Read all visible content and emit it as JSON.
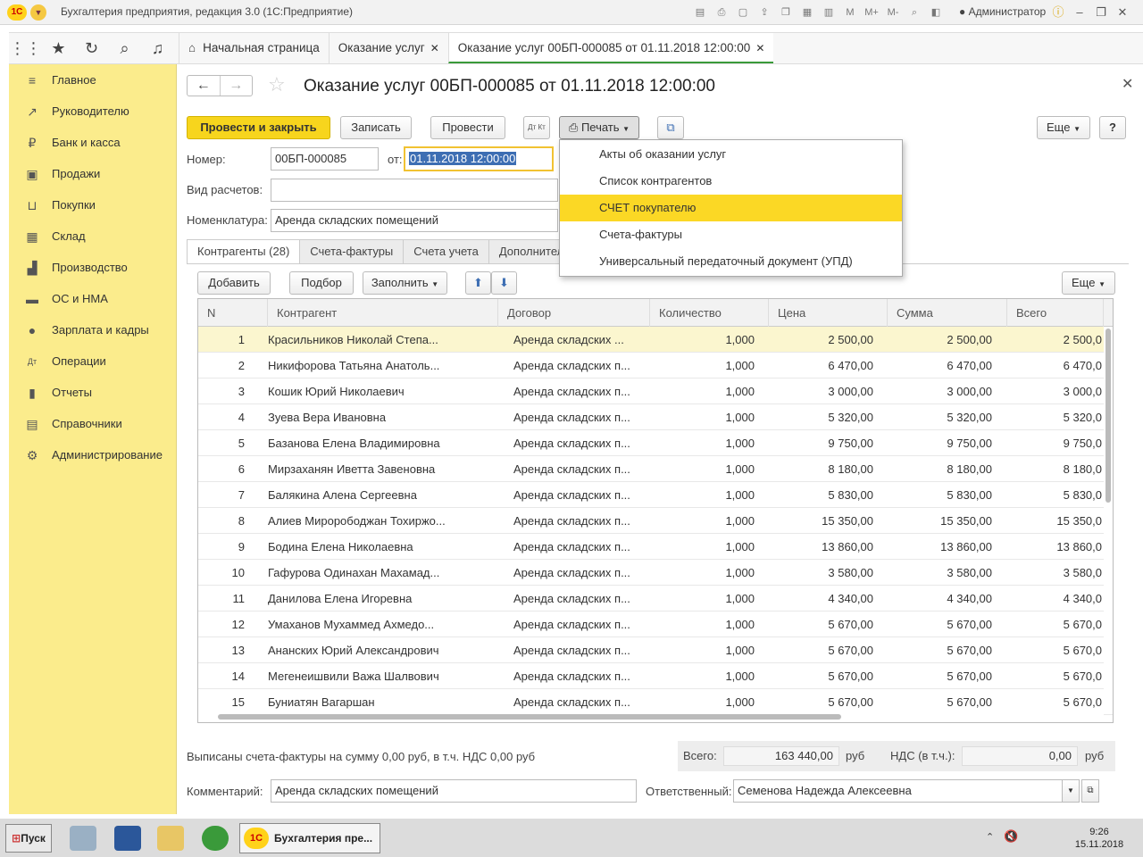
{
  "titlebar": {
    "logo": "1С",
    "title": "Бухгалтерия предприятия, редакция 3.0  (1С:Предприятие)",
    "counters": [
      "M",
      "M+",
      "M-"
    ],
    "user": "Администратор"
  },
  "nav_tabs": [
    {
      "label": "Начальная страница",
      "closable": false
    },
    {
      "label": "Оказание услуг",
      "closable": true
    },
    {
      "label": "Оказание услуг 00БП-000085 от 01.11.2018 12:00:00",
      "closable": true
    }
  ],
  "sidebar": {
    "items": [
      {
        "icon": "menu-icon",
        "glyph": "≡",
        "label": "Главное"
      },
      {
        "icon": "trend-icon",
        "glyph": "↗",
        "label": "Руководителю"
      },
      {
        "icon": "ruble-icon",
        "glyph": "₽",
        "label": "Банк и касса"
      },
      {
        "icon": "bag-icon",
        "glyph": "▣",
        "label": "Продажи"
      },
      {
        "icon": "cart-icon",
        "glyph": "⊔",
        "label": "Покупки"
      },
      {
        "icon": "warehouse-icon",
        "glyph": "▦",
        "label": "Склад"
      },
      {
        "icon": "factory-icon",
        "glyph": "▟",
        "label": "Производство"
      },
      {
        "icon": "truck-icon",
        "glyph": "▬",
        "label": "ОС и НМА"
      },
      {
        "icon": "person-icon",
        "glyph": "●",
        "label": "Зарплата и кадры"
      },
      {
        "icon": "dt-kt-icon",
        "glyph": "Дт",
        "label": "Операции"
      },
      {
        "icon": "bar-chart-icon",
        "glyph": "▮",
        "label": "Отчеты"
      },
      {
        "icon": "book-icon",
        "glyph": "▤",
        "label": "Справочники"
      },
      {
        "icon": "gear-icon",
        "glyph": "⚙",
        "label": "Администрирование"
      }
    ]
  },
  "doc": {
    "title": "Оказание услуг 00БП-000085 от 01.11.2018 12:00:00",
    "buttons": {
      "post_close": "Провести и закрыть",
      "save": "Записать",
      "post": "Провести",
      "dtkt": "Дт Кт",
      "print": "Печать",
      "more": "Еще",
      "help": "?"
    },
    "number_label": "Номер:",
    "number": "00БП-000085",
    "from_label": "от:",
    "date": "01.11.2018 12:00:00",
    "settlement_label": "Вид расчетов:",
    "settlement": "",
    "nomenclature_label": "Номенклатура:",
    "nomenclature": "Аренда складских помещений"
  },
  "print_menu": {
    "items": [
      "Акты об оказании услуг",
      "Список контрагентов",
      "СЧЕТ покупателю",
      "Счета-фактуры",
      "Универсальный передаточный документ (УПД)"
    ],
    "highlighted": 2
  },
  "subtabs": [
    "Контрагенты (28)",
    "Счета-фактуры",
    "Счета учета",
    "Дополнительно"
  ],
  "table_toolbar": {
    "add": "Добавить",
    "pick": "Подбор",
    "fill": "Заполнить",
    "more": "Еще"
  },
  "table": {
    "columns": [
      "N",
      "Контрагент",
      "Договор",
      "Количество",
      "Цена",
      "Сумма",
      "Всего"
    ],
    "rows": [
      [
        "1",
        "Красильников Николай Степа...",
        "Аренда складских  ...",
        "1,000",
        "2 500,00",
        "2 500,00",
        "2 500,0"
      ],
      [
        "2",
        "Никифорова Татьяна Анатоль...",
        "Аренда складских п...",
        "1,000",
        "6 470,00",
        "6 470,00",
        "6 470,0"
      ],
      [
        "3",
        "Кошик Юрий Николаевич",
        "Аренда складских п...",
        "1,000",
        "3 000,00",
        "3 000,00",
        "3 000,0"
      ],
      [
        "4",
        "Зуева Вера Ивановна",
        "Аренда складских п...",
        "1,000",
        "5 320,00",
        "5 320,00",
        "5 320,0"
      ],
      [
        "5",
        "Базанова Елена Владимировна",
        "Аренда складских п...",
        "1,000",
        "9 750,00",
        "9 750,00",
        "9 750,0"
      ],
      [
        "6",
        "Мирзаханян Иветта Завеновна",
        "Аренда складских п...",
        "1,000",
        "8 180,00",
        "8 180,00",
        "8 180,0"
      ],
      [
        "7",
        "Балякина Алена Сергеевна",
        "Аренда складских п...",
        "1,000",
        "5 830,00",
        "5 830,00",
        "5 830,0"
      ],
      [
        "8",
        "Алиев Мирорободжан Тохиржо...",
        "Аренда складских п...",
        "1,000",
        "15 350,00",
        "15 350,00",
        "15 350,0"
      ],
      [
        "9",
        "Бодина Елена Николаевна",
        "Аренда складских п...",
        "1,000",
        "13 860,00",
        "13 860,00",
        "13 860,0"
      ],
      [
        "10",
        "Гафурова Одинахан Махамад...",
        "Аренда складских п...",
        "1,000",
        "3 580,00",
        "3 580,00",
        "3 580,0"
      ],
      [
        "11",
        "Данилова Елена Игоревна",
        "Аренда складских п...",
        "1,000",
        "4 340,00",
        "4 340,00",
        "4 340,0"
      ],
      [
        "12",
        "Умаханов Мухаммед Ахмедо...",
        "Аренда складских п...",
        "1,000",
        "5 670,00",
        "5 670,00",
        "5 670,0"
      ],
      [
        "13",
        "Ананских Юрий Александрович",
        "Аренда складских п...",
        "1,000",
        "5 670,00",
        "5 670,00",
        "5 670,0"
      ],
      [
        "14",
        "Мегенеишвили Важа Шалвович",
        "Аренда складских п...",
        "1,000",
        "5 670,00",
        "5 670,00",
        "5 670,0"
      ],
      [
        "15",
        "Буниатян Вагаршан",
        "Аренда складских п...",
        "1,000",
        "5 670,00",
        "5 670,00",
        "5 670,0"
      ]
    ]
  },
  "footer": {
    "invoices_text": "Выписаны счета-фактуры на сумму 0,00 руб, в т.ч. НДС 0,00 руб",
    "total_label": "Всего:",
    "total": "163 440,00",
    "total_cur": "руб",
    "vat_label": "НДС (в т.ч.):",
    "vat": "0,00",
    "vat_cur": "руб",
    "comment_label": "Комментарий:",
    "comment": "Аренда складских помещений",
    "responsible_label": "Ответственный:",
    "responsible": "Семенова Надежда Алексеевна"
  },
  "taskbar": {
    "start": "Пуск",
    "app": "Бухгалтерия пре...",
    "time": "9:26",
    "date": "15.11.2018"
  },
  "colors": {
    "sidebar_bg": "#fbec8c",
    "accent_yellow": "#f7d51d",
    "menu_highlight": "#fbd825",
    "selection_blue": "#3d6eb3"
  }
}
